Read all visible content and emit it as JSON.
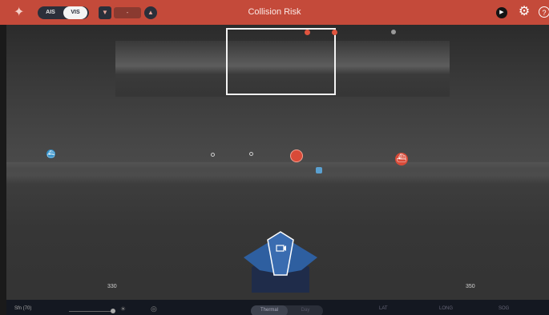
{
  "topbar": {
    "title": "Collision Risk",
    "toggle": {
      "ais_label": "AIS",
      "vis_label": "VIS",
      "selected": "VIS"
    },
    "zoom_value": "-",
    "icons": [
      "logo-icon",
      "zoom-down-icon",
      "zoom-up-icon",
      "play-icon",
      "gear-icon",
      "help-icon"
    ],
    "help_label": "?",
    "accent_color": "#c44a3a"
  },
  "compass": {
    "labels": [
      "330",
      "350"
    ]
  },
  "bottombar": {
    "speed_label": "Sfn (70)",
    "mode_primary": "Thermal",
    "mode_secondary": "Day",
    "lat_label": "LAT",
    "long_label": "LONG",
    "sog_label": "SOG"
  },
  "targets": {
    "risk_color": "#e0553f",
    "neutral_color": "#bbbbbb",
    "ais_color": "#4a88c4"
  }
}
